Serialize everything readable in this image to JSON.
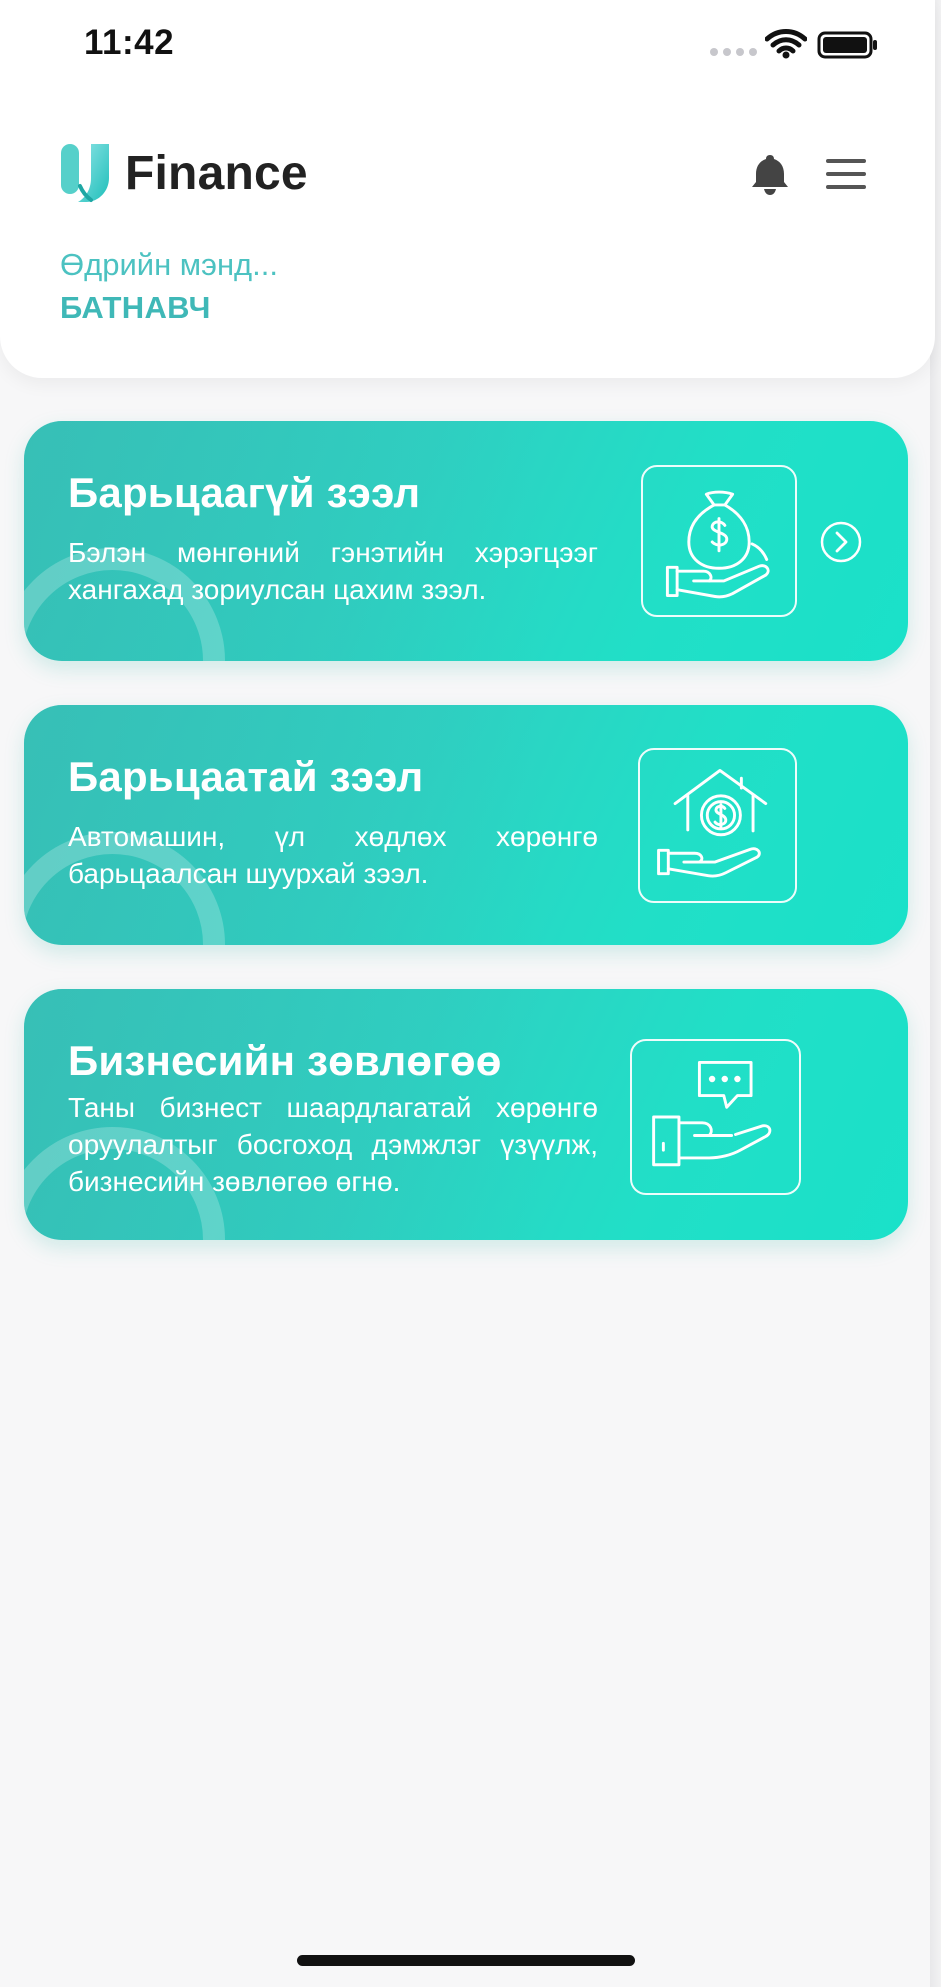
{
  "status_bar": {
    "time": "11:42"
  },
  "header": {
    "app_name": "Finance",
    "greeting": "Өдрийн мэнд...",
    "user_name": "БАТНАВЧ",
    "notification_icon": "bell-icon",
    "menu_icon": "menu-icon"
  },
  "cards": [
    {
      "title": "Барьцаагүй зээл",
      "description": "Бэлэн мөнгөний гэнэтийн хэрэгцээг хангахад зориулсан цахим зээл.",
      "icon": "money-bag-hand-icon",
      "has_arrow": true
    },
    {
      "title": "Барьцаатай зээл",
      "description": "Автомашин, үл хөдлөх хөрөнгө барьцаалсан шуурхай зээл.",
      "icon": "house-coin-hand-icon"
    },
    {
      "title": "Бизнесийн зөвлөгөө",
      "description": "Таны бизнест шаардлагатай хөрөнгө оруулалтыг босгоход дэмжлэг үзүүлж, бизнесийн зөвлөгөө өгнө.",
      "icon": "consultation-hand-icon"
    }
  ],
  "colors": {
    "accent": "#3fb8b7",
    "card_gradient_start": "#39c6bd",
    "card_gradient_end": "#1ae1c9",
    "background": "#f7f7f8"
  }
}
